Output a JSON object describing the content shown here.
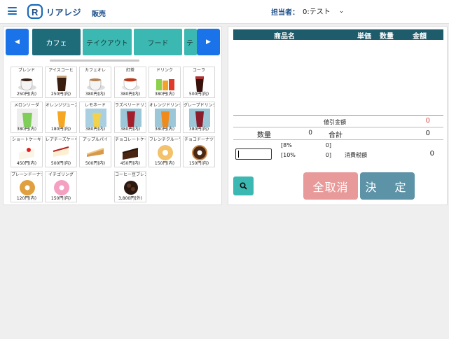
{
  "header": {
    "logo_text": "リアレジ",
    "nav_sales": "販売",
    "staff_label": "担当者：",
    "staff_value": "0:テスト",
    "brand_color": "#1e6bb8"
  },
  "categories": {
    "prev_label": "◀",
    "next_label": "▶",
    "tabs": [
      {
        "label": "カフェ",
        "active": true
      },
      {
        "label": "テイクアウト",
        "active": false
      },
      {
        "label": "フード",
        "active": false
      },
      {
        "label": "テ",
        "active": false
      }
    ]
  },
  "products": [
    {
      "name": "ブレンド",
      "price": "250円(内)",
      "icon": "coffee-cup-icon"
    },
    {
      "name": "アイスコーヒ",
      "price": "250円(内)",
      "icon": "iced-coffee-icon"
    },
    {
      "name": "カフェオレ",
      "price": "380円(内)",
      "icon": "cafe-au-lait-icon"
    },
    {
      "name": "紅茶",
      "price": "380円(内)",
      "icon": "tea-cup-icon"
    },
    {
      "name": "ドリンク",
      "price": "380円(内)",
      "icon": "drinks-icon"
    },
    {
      "name": "コーラ",
      "price": "500円(内)",
      "icon": "cola-icon"
    },
    {
      "name": "メロンソーダ",
      "price": "380円(内)",
      "icon": "melon-soda-icon"
    },
    {
      "name": "オレンジジュース",
      "price": "180円(内)",
      "icon": "orange-juice-icon"
    },
    {
      "name": "レモネード",
      "price": "380円(内)",
      "icon": "lemonade-icon"
    },
    {
      "name": "ラズベリードリンク",
      "price": "380円(内)",
      "icon": "raspberry-drink-icon"
    },
    {
      "name": "オレンジドリンク",
      "price": "380円(内)",
      "icon": "orange-drink-icon"
    },
    {
      "name": "グレープドリンク",
      "price": "380円(内)",
      "icon": "grape-drink-icon"
    },
    {
      "name": "ショートケーキ",
      "price": "450円(内)",
      "icon": "shortcake-icon"
    },
    {
      "name": "レアチーズケーキ",
      "price": "500円(内)",
      "icon": "cheesecake-icon"
    },
    {
      "name": "アップルパイ",
      "price": "500円(内)",
      "icon": "apple-pie-icon"
    },
    {
      "name": "チョコレートケーキ",
      "price": "450円(内)",
      "icon": "chocolate-cake-icon"
    },
    {
      "name": "フレンチクルーラー",
      "price": "150円(内)",
      "icon": "cruller-icon"
    },
    {
      "name": "チョコドーナツ",
      "price": "150円(内)",
      "icon": "choco-donut-icon"
    },
    {
      "name": "プレーンドーナツ",
      "price": "120円(内)",
      "icon": "plain-donut-icon"
    },
    {
      "name": "イチゴリング",
      "price": "150円(内)",
      "icon": "strawberry-ring-icon"
    },
    {
      "name": "コーヒー豆ブレンド",
      "price": "3,800円(外)",
      "icon": "coffee-beans-icon"
    }
  ],
  "order": {
    "col_item": "商品名",
    "col_unit": "単価",
    "col_qty": "数量",
    "col_amount": "金額",
    "discount_label": "値引金額",
    "discount_value": "0",
    "qty_label": "数量",
    "qty_value": "0",
    "total_label": "合計",
    "total_value": "0",
    "tax8_label": "[8%",
    "tax8_value": "0]",
    "tax10_label": "[10%",
    "tax10_value": "0]",
    "tax_label": "消費税額",
    "tax_value": "0",
    "cash_value": ""
  },
  "actions": {
    "cancel_all": "全取消",
    "decide": "決　定"
  }
}
